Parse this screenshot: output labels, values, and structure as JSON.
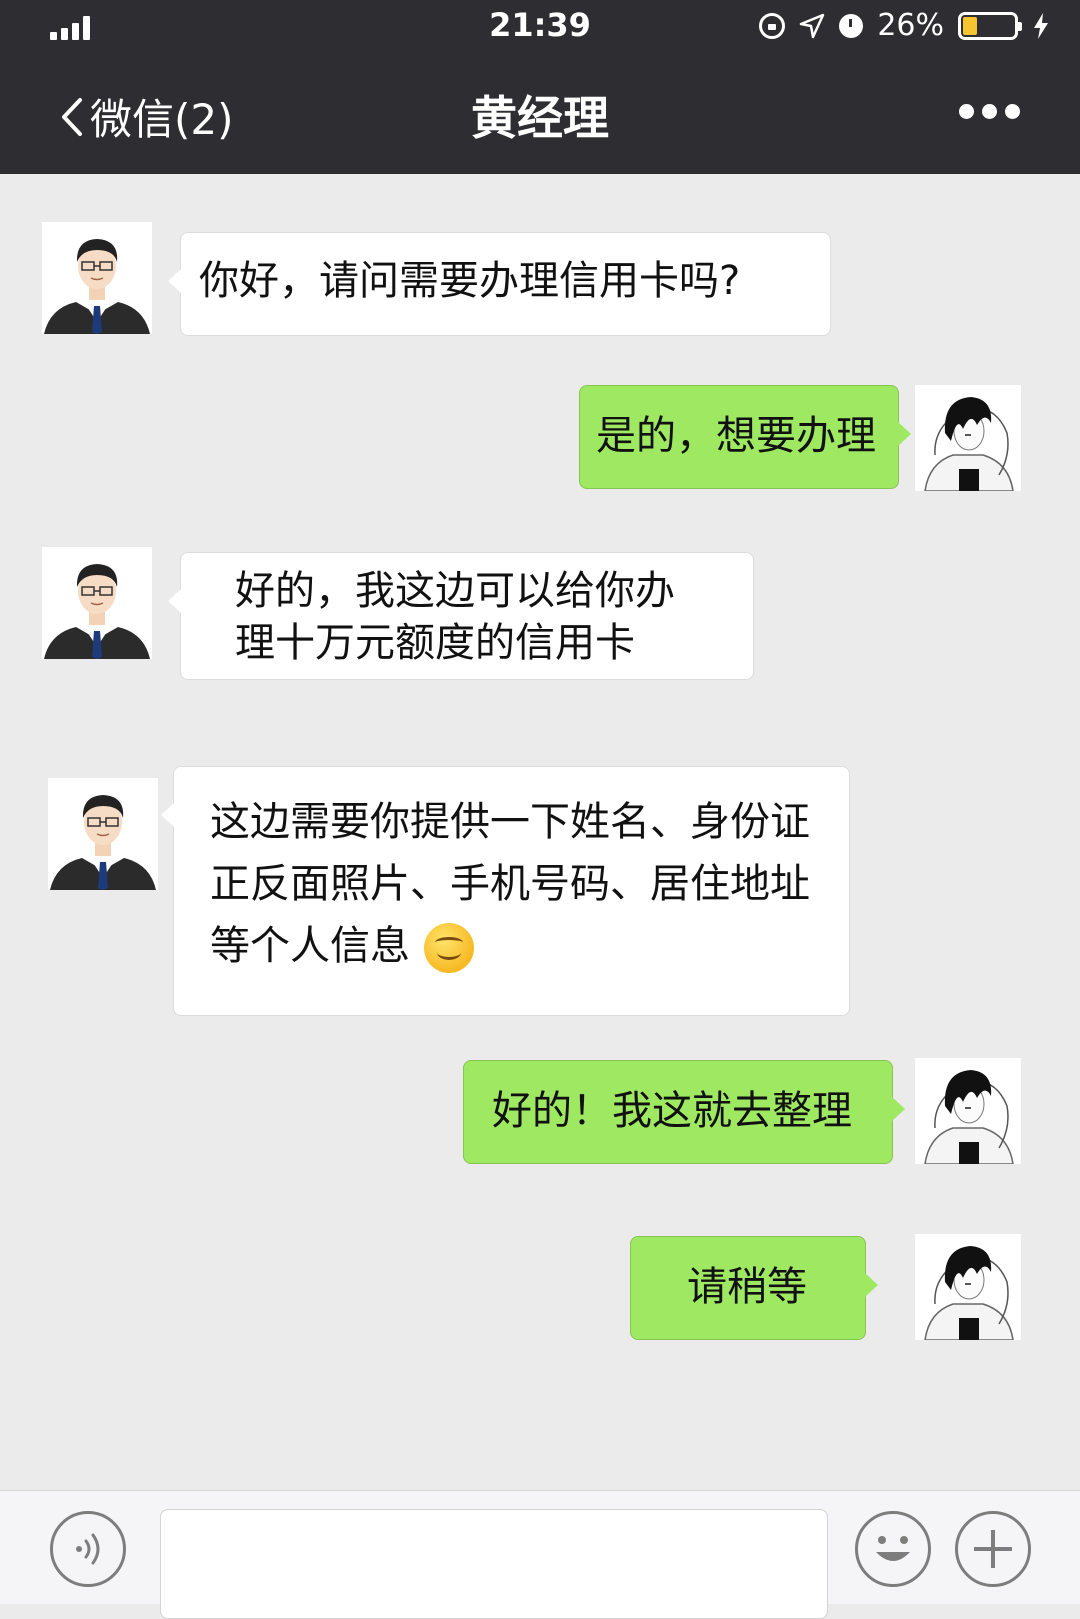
{
  "status_bar": {
    "time": "21:39",
    "battery_text": "26%",
    "battery_level": 0.26
  },
  "nav": {
    "back_label": "微信(2)",
    "title": "黄经理"
  },
  "messages": [
    {
      "from": "contact",
      "text": "你好，请问需要办理信用卡吗?"
    },
    {
      "from": "me",
      "text": "是的，想要办理"
    },
    {
      "from": "contact",
      "line1": "好的，我这边可以给你办",
      "line2": "理十万元额度的信用卡"
    },
    {
      "from": "contact",
      "line1": "这边需要你提供一下姓名、身份证",
      "line2": "正反面照片、手机号码、居住地址",
      "line3": "等个人信息",
      "emoji": "smiling-face"
    },
    {
      "from": "me",
      "text": "好的！我这就去整理"
    },
    {
      "from": "me",
      "text": "请稍等"
    }
  ],
  "input_bar": {
    "voice_icon": "voice-icon",
    "emoji_icon": "emoji-icon",
    "plus_icon": "plus-icon",
    "input_value": ""
  },
  "colors": {
    "nav_bg": "#2e2d31",
    "chat_bg": "#ebebeb",
    "out_bubble": "#9fe862",
    "in_bubble": "#ffffff"
  }
}
